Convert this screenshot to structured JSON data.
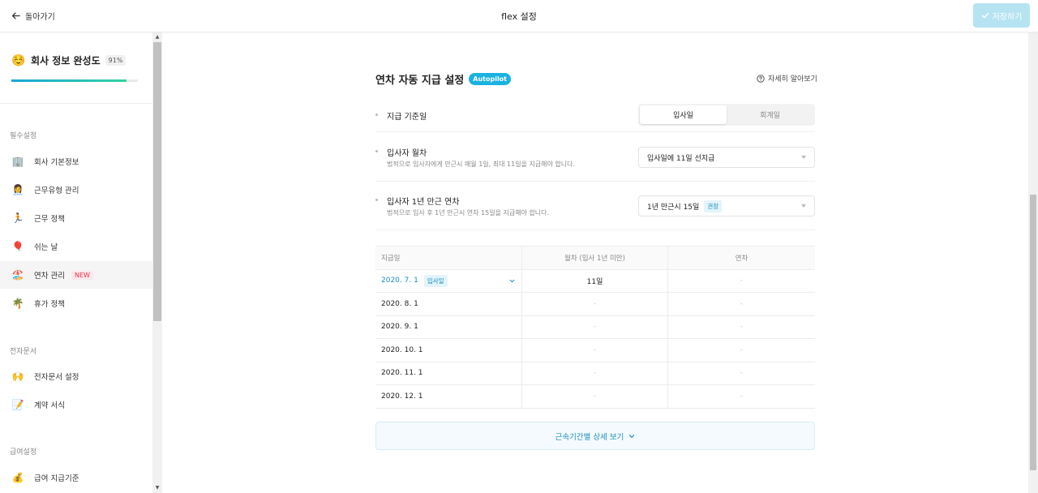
{
  "topbar": {
    "back_label": "돌아가기",
    "title": "flex 설정",
    "save_label": "저장하기"
  },
  "sidebar": {
    "completion": {
      "emoji": "☺️",
      "label": "회사 정보 완성도",
      "percent": "91%",
      "progress": 0.91
    },
    "sections": [
      {
        "title": "필수설정",
        "items": [
          {
            "icon": "🏢",
            "label": "회사 기본정보"
          },
          {
            "icon": "👩‍💼",
            "label": "근무유형 관리"
          },
          {
            "icon": "🏃",
            "label": "근무 정책"
          },
          {
            "icon": "🎈",
            "label": "쉬는 날"
          },
          {
            "icon": "🏖️",
            "label": "연차 관리",
            "badge": "NEW",
            "active": true
          },
          {
            "icon": "🌴",
            "label": "휴가 정책"
          }
        ]
      },
      {
        "title": "전자문서",
        "items": [
          {
            "icon": "🙌",
            "label": "전자문서 설정"
          },
          {
            "icon": "📝",
            "label": "계약 서식"
          }
        ]
      },
      {
        "title": "급여설정",
        "items": [
          {
            "icon": "💰",
            "label": "급여 지급기준"
          }
        ]
      }
    ]
  },
  "main": {
    "title": "연차 자동 지급 설정",
    "autopilot": "Autopilot",
    "learn_more": "자세히 알아보기",
    "rows": [
      {
        "label": "지급 기준일",
        "segments": [
          "입사일",
          "회계일"
        ],
        "selected": "입사일"
      },
      {
        "label": "입사자 월차",
        "desc": "법적으로 입사자에게 만근시 매월 1일, 최대 11일을 지급해야 합니다.",
        "select_value": "입사일에 11일 선지급"
      },
      {
        "label": "입사자 1년 만근 연차",
        "desc": "법적으로 입사 후 1년 만근시 연차 15일을 지급해야 합니다.",
        "select_value": "1년 만근시 15일",
        "select_badge": "권장"
      }
    ],
    "table": {
      "headers": [
        "지급일",
        "월차 (입사 1년 미만)",
        "연차"
      ],
      "rows": [
        {
          "date": "2020. 7. 1",
          "tag": "입사일",
          "monthly": "11일",
          "annual": "-"
        },
        {
          "date": "2020. 8. 1",
          "monthly": "-",
          "annual": "-"
        },
        {
          "date": "2020. 9. 1",
          "monthly": "-",
          "annual": "-"
        },
        {
          "date": "2020. 10. 1",
          "monthly": "-",
          "annual": "-"
        },
        {
          "date": "2020. 11. 1",
          "monthly": "-",
          "annual": "-"
        },
        {
          "date": "2020. 12. 1",
          "monthly": "-",
          "annual": "-"
        }
      ]
    },
    "more_label": "근속기간별 상세 보기"
  }
}
